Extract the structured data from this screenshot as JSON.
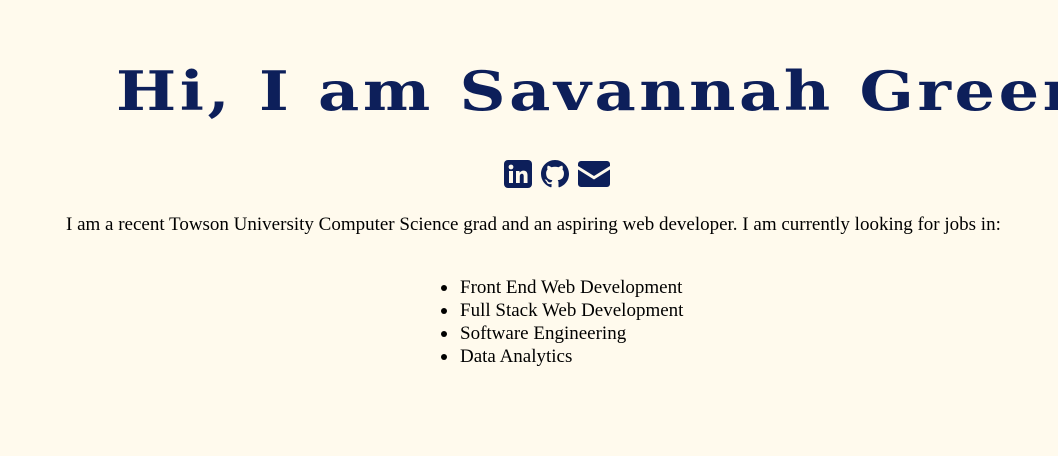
{
  "theme": {
    "background": "#fffaed",
    "accent": "#0d1f5a",
    "text": "#000000"
  },
  "header": {
    "title": "Hi, I am Savannah Green"
  },
  "social_links": [
    {
      "icon": "linkedin-icon"
    },
    {
      "icon": "github-icon"
    },
    {
      "icon": "email-icon"
    }
  ],
  "intro": {
    "text": "I am a recent Towson University Computer Science grad and an aspiring web developer. I am currently looking for jobs in:"
  },
  "jobs": [
    "Front End Web Development",
    "Full Stack Web Development",
    "Software Engineering",
    "Data Analytics"
  ]
}
